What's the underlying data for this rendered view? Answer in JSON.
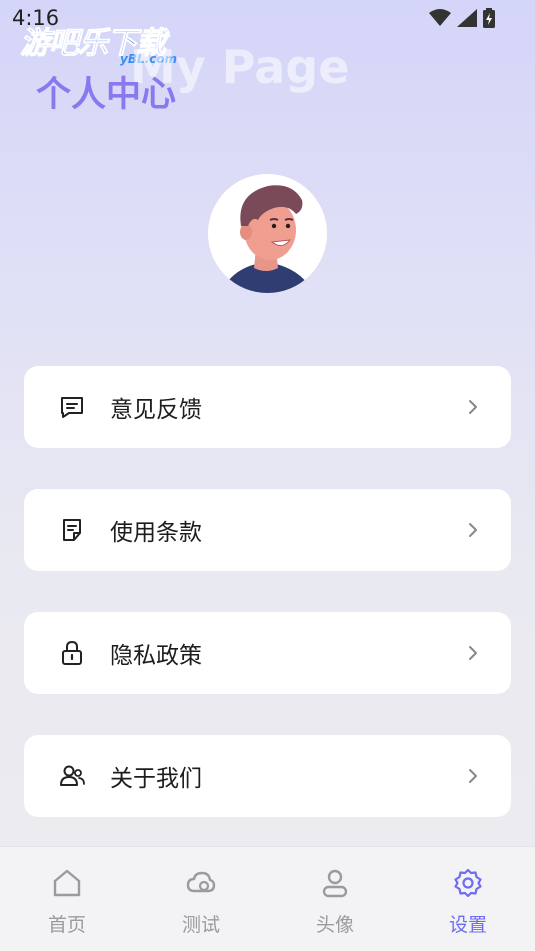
{
  "status_bar": {
    "time": "4:16"
  },
  "watermark": {
    "title": "游吧乐下载",
    "domain": "yBL.com"
  },
  "header": {
    "ghost_title": "My Page",
    "title": "个人中心"
  },
  "menu": [
    {
      "label": "意见反馈",
      "icon": "feedback-icon"
    },
    {
      "label": "使用条款",
      "icon": "document-icon"
    },
    {
      "label": "隐私政策",
      "icon": "lock-icon"
    },
    {
      "label": "关于我们",
      "icon": "users-icon"
    }
  ],
  "tabbar": {
    "items": [
      {
        "label": "首页",
        "icon": "home-icon",
        "active": false
      },
      {
        "label": "测试",
        "icon": "cloud-icon",
        "active": false
      },
      {
        "label": "头像",
        "icon": "person-icon",
        "active": false
      },
      {
        "label": "设置",
        "icon": "settings-icon",
        "active": true
      }
    ]
  },
  "colors": {
    "accent": "#6e6cf0",
    "title": "#8a78ee",
    "inactive": "#9a9aa0"
  }
}
